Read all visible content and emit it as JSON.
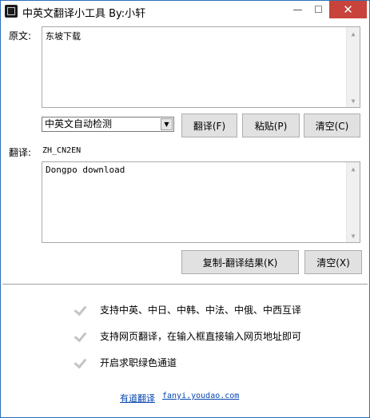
{
  "window": {
    "title": "中英文翻译小工具 By:小轩",
    "min_glyph": "—",
    "max_glyph": "☐",
    "close_glyph": "✕"
  },
  "source": {
    "label": "原文:",
    "text": "东坡下载"
  },
  "controls": {
    "language_select": {
      "selected": "中英文自动检测",
      "arrow_glyph": "▼"
    },
    "translate_button": "翻译(F)",
    "paste_button": "粘贴(P)",
    "clear_button": "清空(C)"
  },
  "result": {
    "label": "翻译:",
    "mode": "ZH_CN2EN",
    "text": "Dongpo download",
    "copy_button": "复制-翻译结果(K)",
    "clear_button": "清空(X)"
  },
  "scroll_glyphs": {
    "up": "▲",
    "down": "▼"
  },
  "features": [
    "支持中英、中日、中韩、中法、中俄、中西互译",
    "支持网页翻译，在输入框直接输入网页地址即可",
    "开启求职绿色通道"
  ],
  "footer_link": {
    "label": "有道翻译",
    "url_text": "fanyi.youdao.com"
  }
}
